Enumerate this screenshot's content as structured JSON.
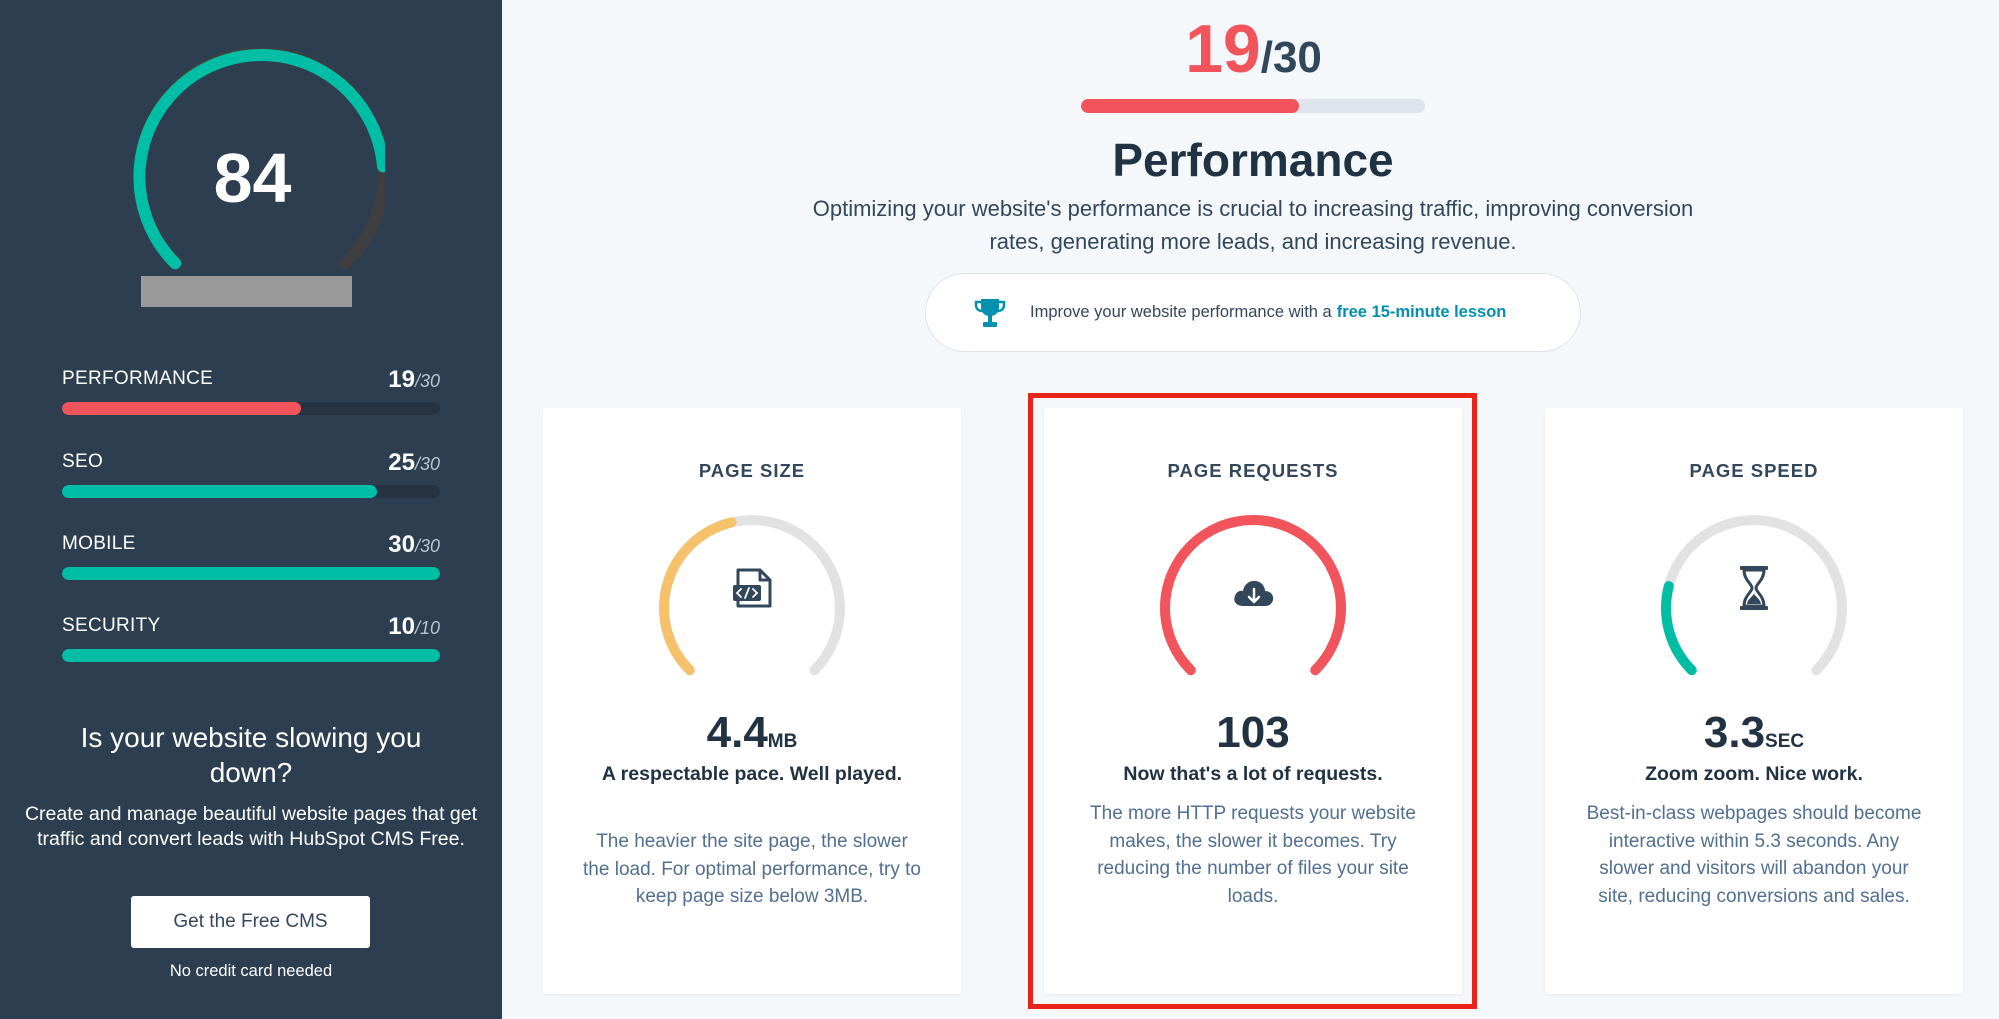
{
  "sidebar": {
    "overall_score": "84",
    "metrics": [
      {
        "name": "PERFORMANCE",
        "score": "19",
        "max": "/30",
        "fraction": 0.633,
        "color": "#f2545b"
      },
      {
        "name": "SEO",
        "score": "25",
        "max": "/30",
        "fraction": 0.833,
        "color": "#00bda5"
      },
      {
        "name": "MOBILE",
        "score": "30",
        "max": "/30",
        "fraction": 1.0,
        "color": "#00bda5"
      },
      {
        "name": "SECURITY",
        "score": "10",
        "max": "/10",
        "fraction": 1.0,
        "color": "#00bda5"
      }
    ],
    "promo_title": "Is your website slowing you down?",
    "promo_text": "Create and manage beautiful website pages that get traffic and convert leads with HubSpot CMS Free.",
    "cta_label": "Get the Free CMS",
    "cta_note": "No credit card needed"
  },
  "category": {
    "score": "19",
    "max": "/30",
    "fraction": 0.633,
    "title": "Performance",
    "description": "Optimizing your website's performance is crucial to increasing traffic, improving conversion rates, generating more leads, and increasing revenue.",
    "lesson_text": "Improve your website performance with a",
    "lesson_link": "free 15-minute lesson"
  },
  "cards": [
    {
      "title": "PAGE SIZE",
      "value": "4.4",
      "unit": "MB",
      "verdict": "A respectable pace. Well played.",
      "description": "The heavier the site page, the slower the load. For optimal performance, try to keep page size below 3MB.",
      "icon": "code-file-icon",
      "gauge_fraction": 0.45,
      "gauge_color": "#f5c26b"
    },
    {
      "title": "PAGE REQUESTS",
      "value": "103",
      "unit": "",
      "verdict": "Now that's a lot of requests.",
      "description": "The more HTTP requests your website makes, the slower it becomes. Try reducing the number of files your site loads.",
      "icon": "cloud-download-icon",
      "gauge_fraction": 1.0,
      "gauge_color": "#f2545b"
    },
    {
      "title": "PAGE SPEED",
      "value": "3.3",
      "unit": "SEC",
      "verdict": "Zoom zoom. Nice work.",
      "description": "Best-in-class webpages should become interactive within 5.3 seconds. Any slower and visitors will abandon your site, reducing conversions and sales.",
      "icon": "hourglass-icon",
      "gauge_fraction": 0.22,
      "gauge_color": "#00bda5"
    }
  ],
  "colors": {
    "sidebar_bg": "#2d3e50",
    "accent_red": "#f2545b",
    "accent_teal": "#00bda5",
    "link_blue": "#0091ae",
    "highlight_red": "#e8231a"
  }
}
